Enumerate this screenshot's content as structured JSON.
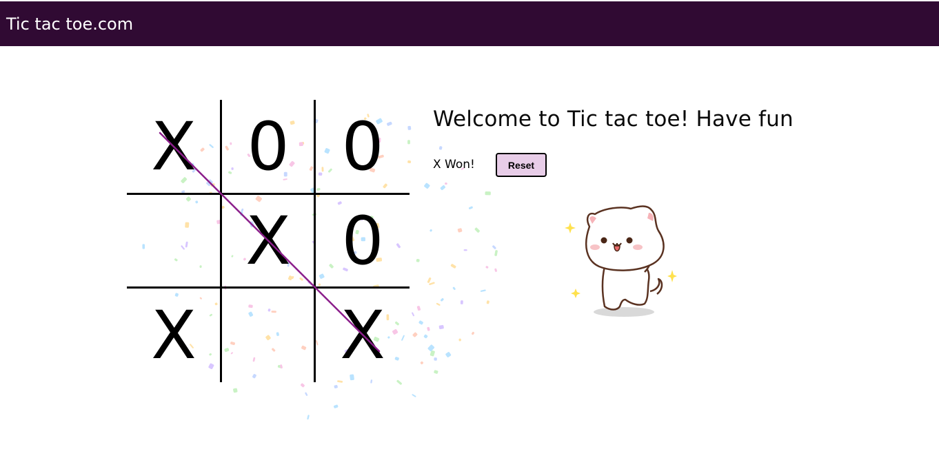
{
  "header": {
    "title": "Tic tac toe.com",
    "background": "#300a33"
  },
  "game": {
    "welcome": "Welcome to Tic tac toe! Have fun",
    "status": "X Won!",
    "reset_label": "Reset",
    "board": [
      "X",
      "0",
      "0",
      "",
      "X",
      "0",
      "X",
      "",
      "X"
    ],
    "winning_line": [
      0,
      4,
      8
    ],
    "winning_line_color": "#8b1e8b",
    "reset_bg": "#e8cde8"
  },
  "illustration": {
    "name": "cat-dancing-illustration"
  }
}
